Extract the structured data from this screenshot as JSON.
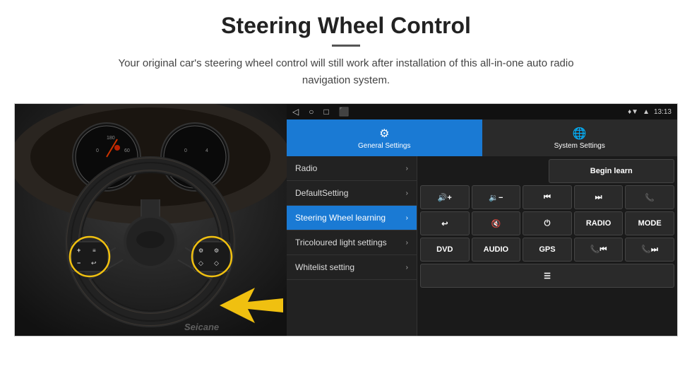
{
  "header": {
    "title": "Steering Wheel Control",
    "subtitle": "Your original car's steering wheel control will still work after installation of this all-in-one auto radio navigation system."
  },
  "status_bar": {
    "nav_icons": [
      "◁",
      "○",
      "□",
      "⬛"
    ],
    "time": "13:13",
    "signal_icons": [
      "♦",
      "▼",
      "wifi"
    ]
  },
  "tabs": [
    {
      "id": "general",
      "label": "General Settings",
      "icon": "⚙",
      "active": true
    },
    {
      "id": "system",
      "label": "System Settings",
      "icon": "🌐",
      "active": false
    }
  ],
  "menu_items": [
    {
      "id": "radio",
      "label": "Radio",
      "active": false
    },
    {
      "id": "default",
      "label": "DefaultSetting",
      "active": false
    },
    {
      "id": "steering",
      "label": "Steering Wheel learning",
      "active": true
    },
    {
      "id": "tricoloured",
      "label": "Tricoloured light settings",
      "active": false
    },
    {
      "id": "whitelist",
      "label": "Whitelist setting",
      "active": false
    }
  ],
  "control_rows": [
    {
      "id": "row1",
      "buttons": [
        {
          "id": "empty1",
          "label": "",
          "type": "empty"
        },
        {
          "id": "begin-learn",
          "label": "Begin learn",
          "type": "normal"
        }
      ]
    },
    {
      "id": "row2",
      "buttons": [
        {
          "id": "vol-up",
          "label": "🔊+",
          "type": "normal"
        },
        {
          "id": "vol-down",
          "label": "🔉−",
          "type": "normal"
        },
        {
          "id": "prev-track",
          "label": "⏮",
          "type": "normal"
        },
        {
          "id": "next-track",
          "label": "⏭",
          "type": "normal"
        },
        {
          "id": "phone",
          "label": "📞",
          "type": "normal"
        }
      ]
    },
    {
      "id": "row3",
      "buttons": [
        {
          "id": "hang-up",
          "label": "↩",
          "type": "normal"
        },
        {
          "id": "mute",
          "label": "🔇",
          "type": "normal"
        },
        {
          "id": "power",
          "label": "⏻",
          "type": "normal"
        },
        {
          "id": "radio-btn",
          "label": "RADIO",
          "type": "normal"
        },
        {
          "id": "mode",
          "label": "MODE",
          "type": "normal"
        }
      ]
    },
    {
      "id": "row4",
      "buttons": [
        {
          "id": "dvd",
          "label": "DVD",
          "type": "normal"
        },
        {
          "id": "audio",
          "label": "AUDIO",
          "type": "normal"
        },
        {
          "id": "gps",
          "label": "GPS",
          "type": "normal"
        },
        {
          "id": "tel-prev",
          "label": "📞⏮",
          "type": "normal"
        },
        {
          "id": "tel-next",
          "label": "📞⏭",
          "type": "normal"
        }
      ]
    },
    {
      "id": "row5",
      "buttons": [
        {
          "id": "menu-icon",
          "label": "☰",
          "type": "normal"
        }
      ]
    }
  ],
  "colors": {
    "active_tab": "#1a7ad4",
    "active_menu": "#1a7ad4",
    "background_dark": "#1a1a1a",
    "button_bg": "#2a2a2a"
  },
  "watermark": "Seicane"
}
